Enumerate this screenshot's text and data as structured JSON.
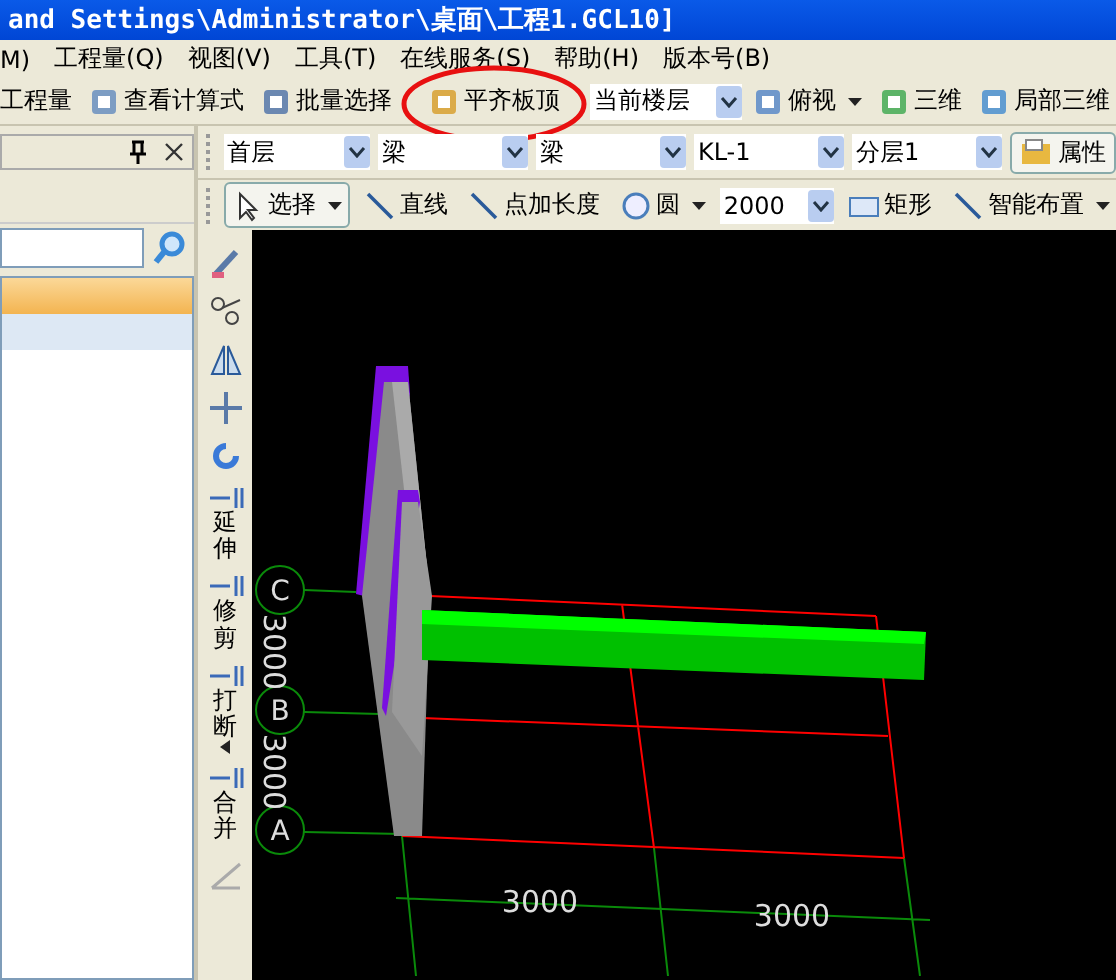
{
  "window": {
    "title": "and Settings\\Administrator\\桌面\\工程1.GCL10]"
  },
  "menu": [
    "M)",
    "工程量(Q)",
    "视图(V)",
    "工具(T)",
    "在线服务(S)",
    "帮助(H)",
    "版本号(B)"
  ],
  "toolbar": [
    {
      "kind": "button",
      "label": "工程量"
    },
    {
      "kind": "button",
      "label": "查看计算式"
    },
    {
      "kind": "button",
      "label": "批量选择"
    },
    {
      "kind": "button",
      "label": "平齐板顶",
      "circled": true
    },
    {
      "kind": "combo",
      "label": "当前楼层"
    },
    {
      "kind": "button",
      "label": "俯视",
      "dropdown": true
    },
    {
      "kind": "button",
      "label": "三维"
    },
    {
      "kind": "button",
      "label": "局部三维"
    }
  ],
  "left_panel": {
    "rows": [
      {
        "selected": true
      },
      {
        "selected": false
      }
    ]
  },
  "filters": [
    "首层",
    "梁",
    "梁",
    "KL-1",
    "分层1"
  ],
  "properties_button": "属性",
  "draw_toolbar": [
    {
      "kind": "button",
      "label": "选择",
      "dropdown": true
    },
    {
      "kind": "button",
      "label": "直线"
    },
    {
      "kind": "button",
      "label": "点加长度"
    },
    {
      "kind": "button",
      "label": "圆",
      "dropdown": true
    },
    {
      "kind": "combo",
      "label": "2000"
    },
    {
      "kind": "button",
      "label": "矩形"
    },
    {
      "kind": "button",
      "label": "智能布置",
      "dropdown": true
    }
  ],
  "side_tools": [
    {
      "label": "延伸"
    },
    {
      "label": "修剪"
    },
    {
      "label": "打断",
      "dropdown": true
    },
    {
      "label": "合并"
    }
  ],
  "canvas": {
    "axis_labels": [
      "C",
      "B",
      "A"
    ],
    "vertical_dimensions": [
      "3000",
      "3000"
    ],
    "horizontal_dimensions": [
      "3000",
      "3000"
    ]
  }
}
